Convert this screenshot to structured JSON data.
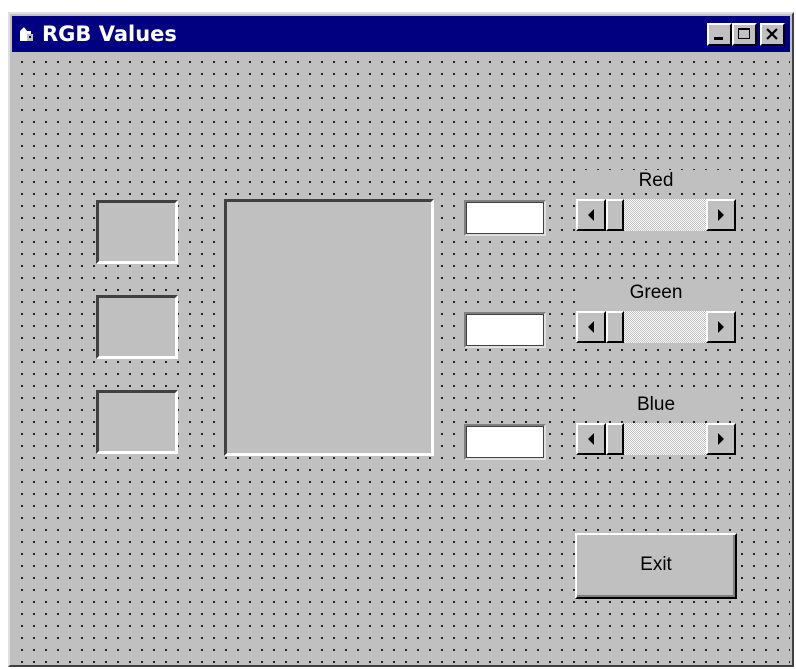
{
  "window": {
    "title": "RGB Values"
  },
  "title_controls": [
    "minimize-icon",
    "maximize-icon",
    "close-icon"
  ],
  "labels": {
    "red": "Red",
    "green": "Green",
    "blue": "Blue"
  },
  "textboxes": {
    "red_value": "",
    "green_value": "",
    "blue_value": ""
  },
  "scrollbars": {
    "red": 0,
    "green": 0,
    "blue": 0
  },
  "buttons": {
    "exit": "Exit"
  },
  "colors": {
    "titlebar": "#000080",
    "face": "#c0c0c0"
  }
}
